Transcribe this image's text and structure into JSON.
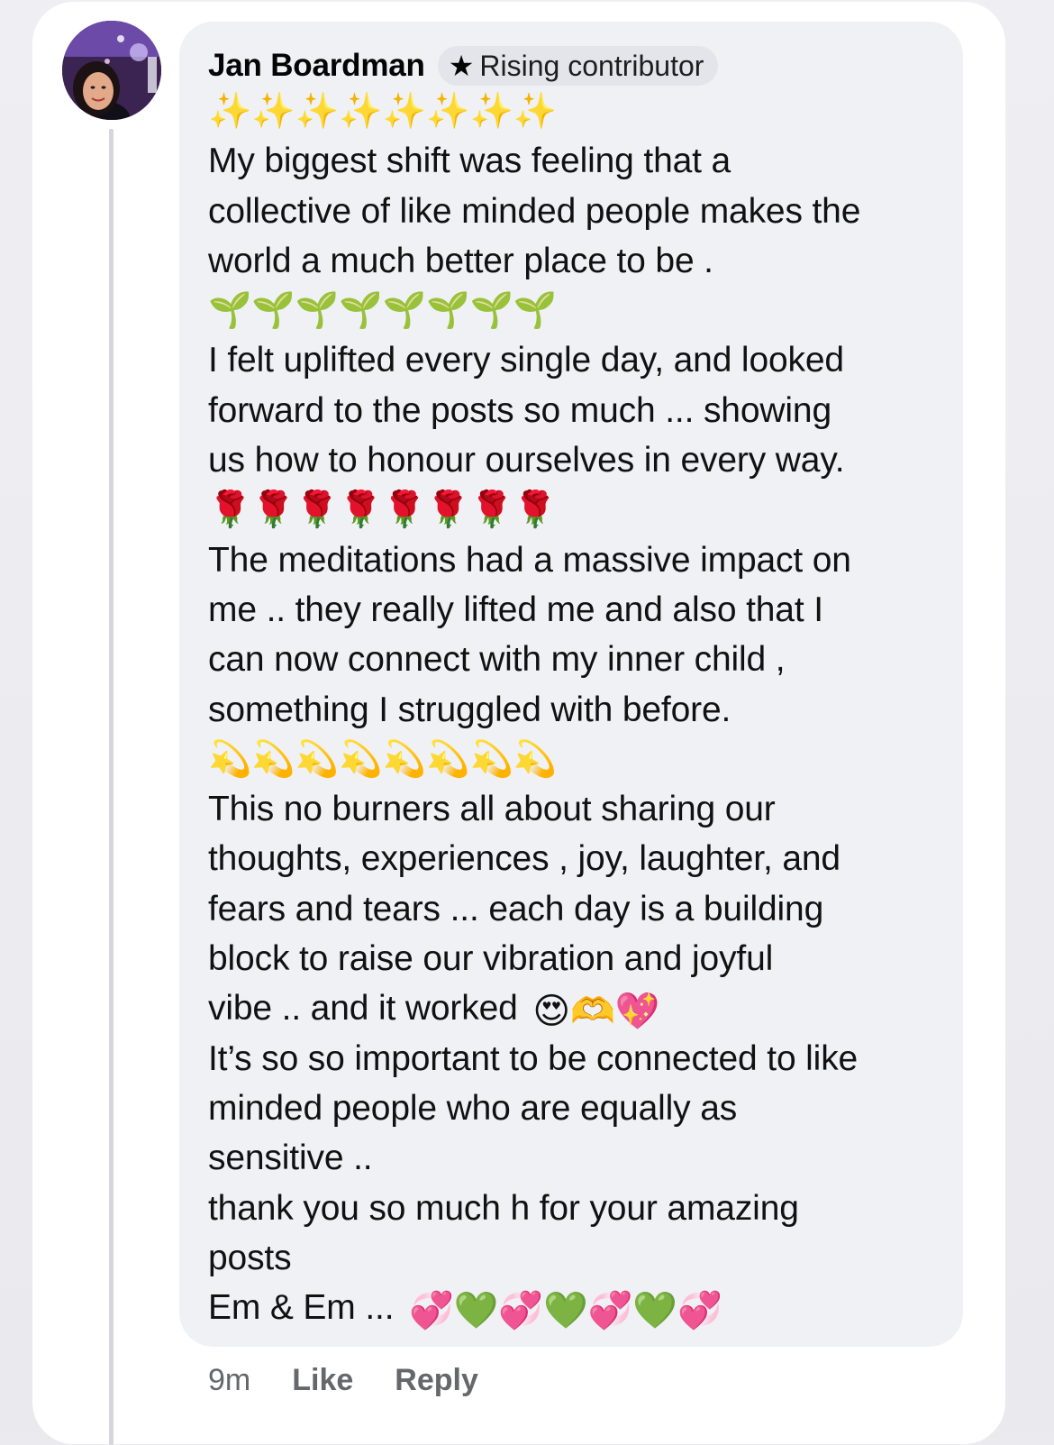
{
  "comment": {
    "author": "Jan Boardman",
    "badge": "Rising contributor",
    "emoji_rows": {
      "sparkles": "✨✨✨✨✨✨✨✨",
      "seedlings": "🌱🌱🌱🌱🌱🌱🌱🌱",
      "roses": "🌹🌹🌹🌹🌹🌹🌹🌹",
      "dizzy": "💫💫💫💫💫💫💫💫"
    },
    "lines": [
      "My biggest shift was feeling that a",
      "collective of like minded people makes the",
      "world a much better place to be .",
      "I felt uplifted every single day, and looked",
      "forward to the posts so much ... showing",
      "us how to honour ourselves in every way.",
      "The meditations had a massive impact on",
      "me .. they really lifted me and also that I",
      "can now connect with my inner child ,",
      "something I struggled with before.",
      "This no burners all about sharing our",
      "thoughts, experiences , joy, laughter, and",
      "fears and tears ... each day is a building",
      "block to raise our vibration and joyful",
      "vibe .. and it worked",
      "It’s so so important to be connected to like",
      "minded people who are equally as",
      "sensitive ..",
      "thank you so much h for your amazing",
      "posts",
      "Em & Em ..."
    ],
    "worked_emojis": "😍🫶💖",
    "signoff_emojis": "💞💚💞💚💞💚💞"
  },
  "footer": {
    "time": "9m",
    "like_label": "Like",
    "reply_label": "Reply"
  }
}
